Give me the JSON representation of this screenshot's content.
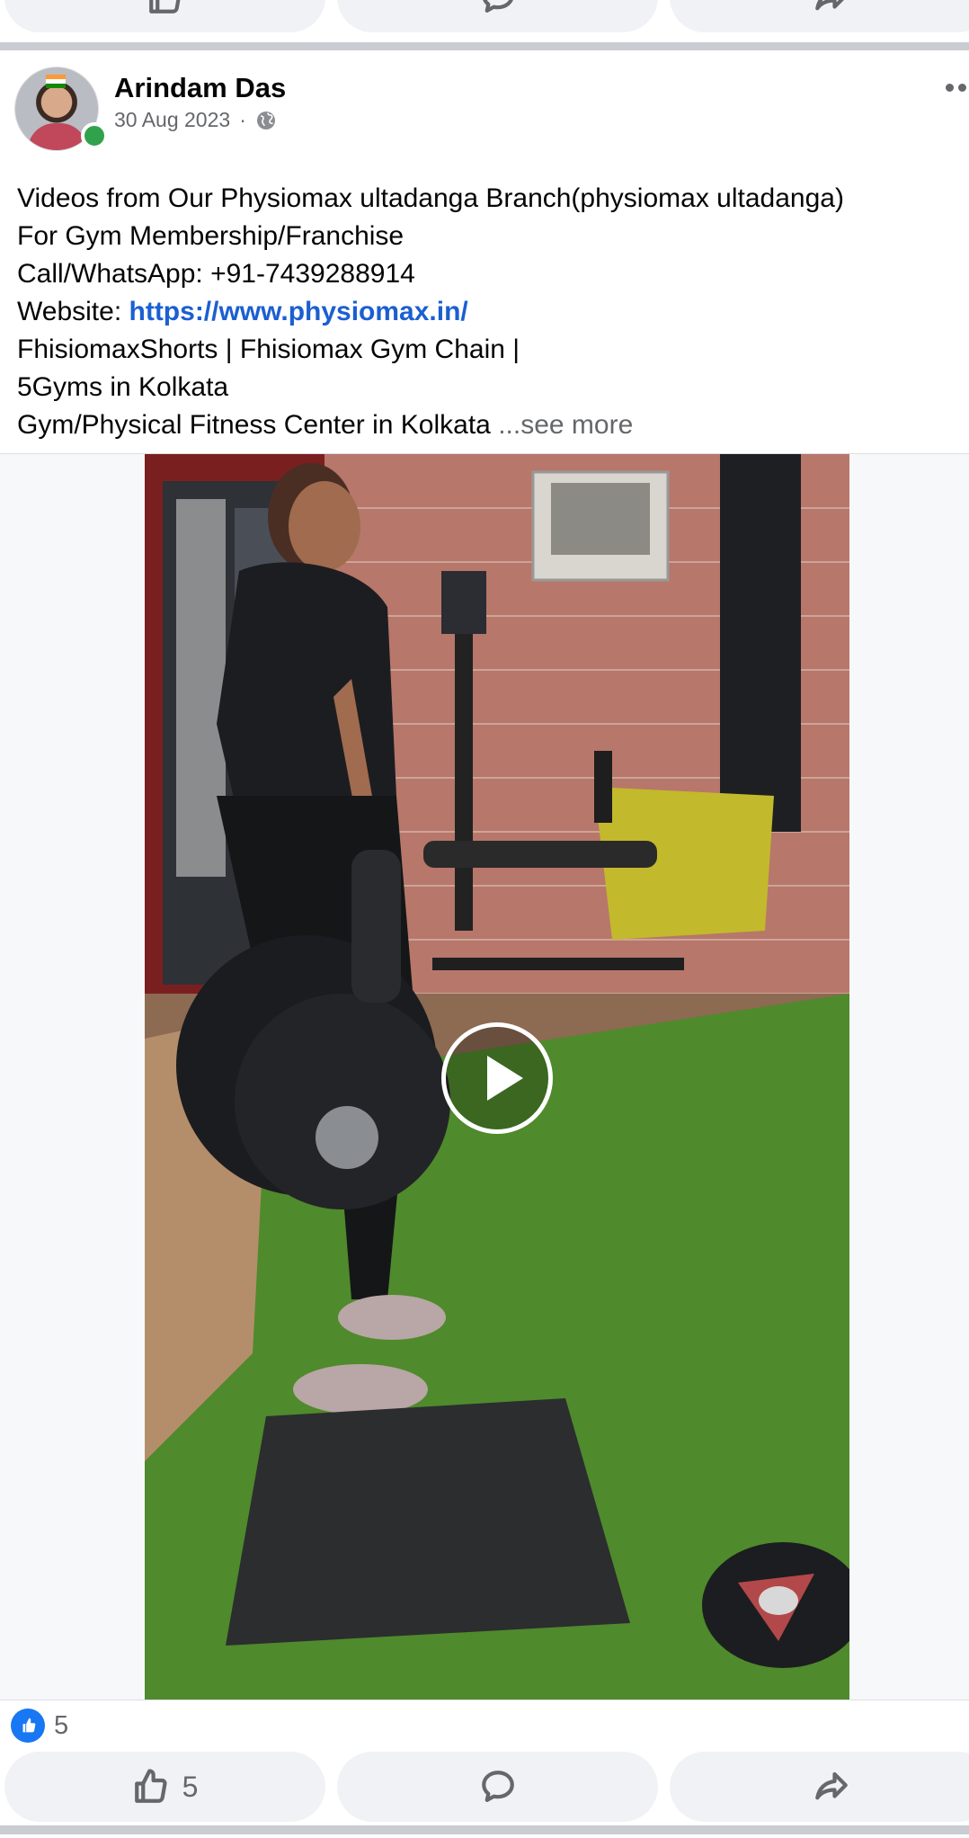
{
  "post": {
    "author": "Arindam Das",
    "date": "30 Aug 2023",
    "separator": "·",
    "lines": [
      "Videos from Our Physiomax ultadanga  Branch(physiomax ultadanga)",
      "For Gym Membership/Franchise",
      "Call/WhatsApp: +91-7439288914"
    ],
    "website_label": "Website: ",
    "website_url": "https://www.physiomax.in/",
    "lines_after": [
      "FhisiomaxShorts | Fhisiomax Gym Chain |",
      "5Gyms in Kolkata"
    ],
    "last_line": "Gym/Physical Fitness Center in Kolkata ",
    "see_more": "...see more"
  },
  "reactions": {
    "count": "5"
  },
  "actions": {
    "like_count": "5"
  },
  "icons": {
    "like": "thumbs-up-icon",
    "comment": "comment-icon",
    "share": "share-icon",
    "privacy": "globe-icon",
    "more": "more-options-icon",
    "play": "play-icon"
  },
  "colors": {
    "link": "#1b5fd1",
    "like_blue": "#1877f2",
    "online_green": "#31a24c",
    "muted": "#65676b",
    "button_bg": "#f0f2f5"
  }
}
